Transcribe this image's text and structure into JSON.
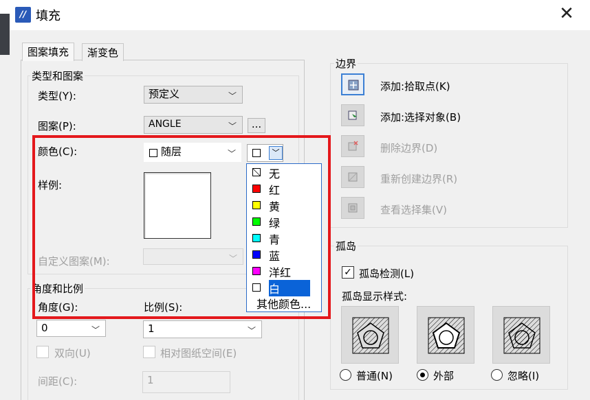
{
  "window": {
    "title": "填充",
    "close": "✕"
  },
  "tabs": [
    {
      "label": "图案填充",
      "active": true
    },
    {
      "label": "渐变色",
      "active": false
    }
  ],
  "type_pattern": {
    "group_title": "类型和图案",
    "type_label": "类型(Y):",
    "type_value": "预定义",
    "pattern_label": "图案(P):",
    "pattern_value": "ANGLE",
    "pattern_browse": "...",
    "color_label": "颜色(C):",
    "color_value": "随层",
    "sample_label": "样例:",
    "custom_label": "自定义图案(M):"
  },
  "angle_scale": {
    "group_title": "角度和比例",
    "angle_label": "角度(G):",
    "angle_value": "0",
    "scale_label": "比例(S):",
    "scale_value": "1",
    "double_label": "双向(U)",
    "relative_label": "相对图纸空间(E)",
    "spacing_label": "间距(C):",
    "spacing_value": "1"
  },
  "color_dropdown": {
    "items": [
      {
        "label": "无",
        "color": "#ffffff"
      },
      {
        "label": "红",
        "color": "#ff0000"
      },
      {
        "label": "黄",
        "color": "#ffff00"
      },
      {
        "label": "绿",
        "color": "#00ff00"
      },
      {
        "label": "青",
        "color": "#00ffff"
      },
      {
        "label": "蓝",
        "color": "#0000ff"
      },
      {
        "label": "洋红",
        "color": "#ff00ff"
      },
      {
        "label": "白",
        "color": "#ffffff",
        "selected": true
      }
    ],
    "other": "其他颜色..."
  },
  "boundary": {
    "group_title": "边界",
    "buttons": [
      {
        "label": "添加:拾取点(K)",
        "icon": "pick-points-icon",
        "enabled": true
      },
      {
        "label": "添加:选择对象(B)",
        "icon": "select-objects-icon",
        "enabled": true
      },
      {
        "label": "删除边界(D)",
        "icon": "remove-boundary-icon",
        "enabled": false
      },
      {
        "label": "重新创建边界(R)",
        "icon": "recreate-boundary-icon",
        "enabled": false
      },
      {
        "label": "查看选择集(V)",
        "icon": "view-selection-icon",
        "enabled": false
      }
    ]
  },
  "islands": {
    "group_title": "孤岛",
    "detect_label": "孤岛检测(L)",
    "style_label": "孤岛显示样式:",
    "styles": [
      {
        "label": "普通(N)",
        "checked": false
      },
      {
        "label": "外部",
        "checked": true
      },
      {
        "label": "忽略(I)",
        "checked": false
      }
    ]
  },
  "colors": {
    "highlight": "#e4181c",
    "selection": "#0a63d8",
    "accent_border": "#3b7fd4"
  }
}
